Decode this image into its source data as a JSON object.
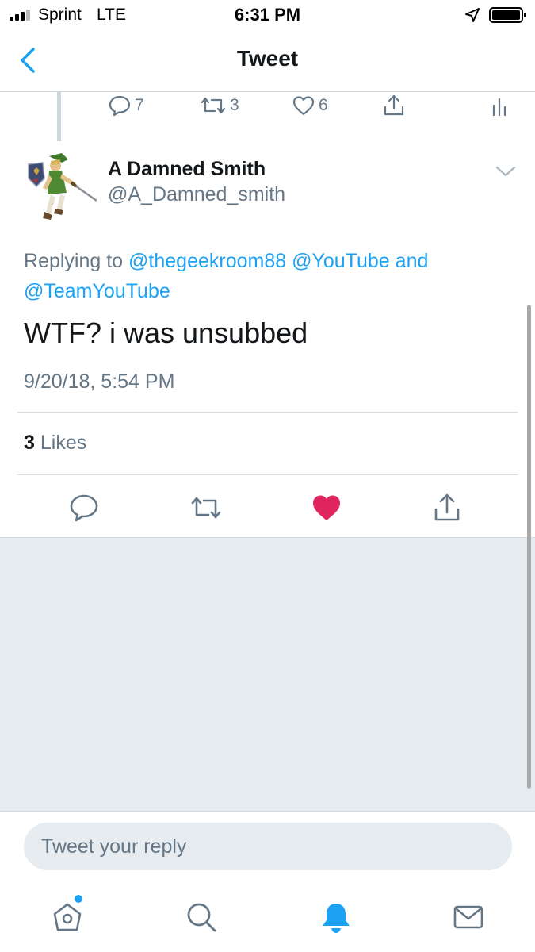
{
  "status_bar": {
    "carrier": "Sprint",
    "network": "LTE",
    "time": "6:31 PM"
  },
  "nav": {
    "title": "Tweet",
    "back_icon": "chevron-left-icon"
  },
  "previous_tweet_actions": {
    "replies": "7",
    "retweets": "3",
    "likes": "6"
  },
  "tweet": {
    "display_name": "A Damned Smith",
    "handle": "@A_Damned_smith",
    "replying_prefix": "Replying to",
    "mention_1": "@thegeekroom88",
    "mention_2": "@YouTube",
    "replying_joiner": "and",
    "mention_3": "@TeamYouTube",
    "text": "WTF? i was unsubbed",
    "timestamp": "9/20/18, 5:54 PM",
    "likes_count": "3",
    "likes_label": "Likes",
    "liked": true
  },
  "reply_box": {
    "placeholder": "Tweet your reply"
  },
  "tabs": [
    "home-icon",
    "search-icon",
    "bell-icon",
    "mail-icon"
  ],
  "colors": {
    "accent": "#1da1f2",
    "like": "#e0245e",
    "muted": "#657786",
    "background_gray": "#e6ecf0"
  }
}
